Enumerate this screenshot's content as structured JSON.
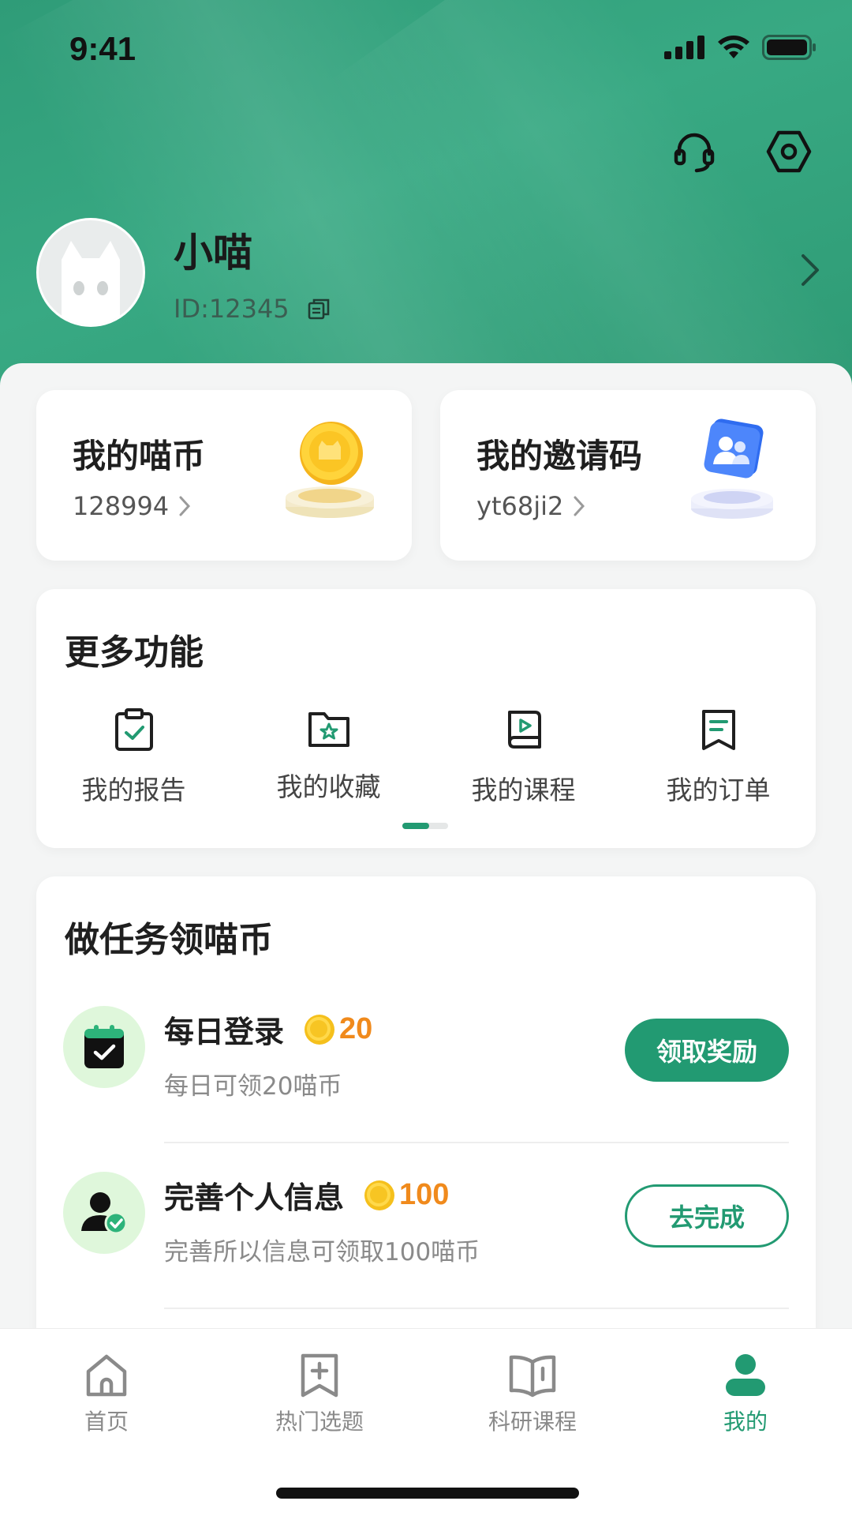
{
  "status_bar": {
    "time": "9:41"
  },
  "header": {
    "icons": [
      "headset-icon",
      "settings-hex-icon"
    ],
    "user": {
      "name": "小喵",
      "id_text": "ID:12345"
    }
  },
  "cards": {
    "coins": {
      "title": "我的喵币",
      "value": "128994"
    },
    "invite": {
      "title": "我的邀请码",
      "value": "yt68ji2"
    }
  },
  "more_functions": {
    "title": "更多功能",
    "items": [
      {
        "label": "我的报告",
        "icon": "report-clipboard-icon"
      },
      {
        "label": "我的收藏",
        "icon": "favorites-folder-icon"
      },
      {
        "label": "我的课程",
        "icon": "course-play-icon"
      },
      {
        "label": "我的订单",
        "icon": "order-receipt-icon"
      }
    ]
  },
  "tasks": {
    "title": "做任务领喵币",
    "items": [
      {
        "title": "每日登录",
        "coins": "20",
        "desc": "每日可领20喵币",
        "button": "领取奖励",
        "button_style": "solid"
      },
      {
        "title": "完善个人信息",
        "coins": "100",
        "desc": "完善所以信息可领取100喵币",
        "button": "去完成",
        "button_style": "outline"
      }
    ]
  },
  "tabbar": {
    "tabs": [
      {
        "label": "首页",
        "icon": "home-icon"
      },
      {
        "label": "热门选题",
        "icon": "bookmark-plus-icon"
      },
      {
        "label": "科研课程",
        "icon": "open-book-icon"
      },
      {
        "label": "我的",
        "icon": "user-icon",
        "active": true
      }
    ]
  },
  "colors": {
    "brand": "#229a72",
    "header_bg": "#38a983",
    "coin": "#f08a1c"
  }
}
